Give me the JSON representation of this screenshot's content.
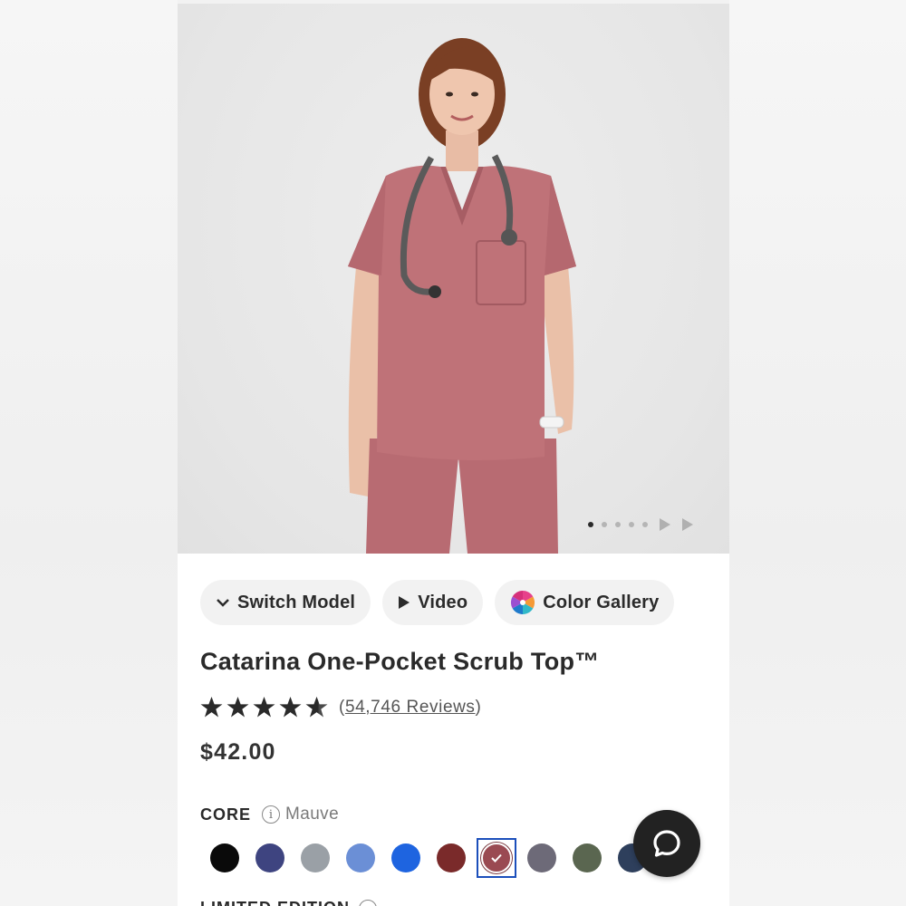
{
  "gallery": {
    "image_alt": "Model wearing mauve scrub top with stethoscope",
    "dot_count": 5,
    "active_dot": 0
  },
  "actions": {
    "switch_model": "Switch Model",
    "video": "Video",
    "color_gallery": "Color Gallery"
  },
  "product": {
    "title": "Catarina One-Pocket Scrub Top™",
    "rating": 4.5,
    "reviews_open": "(",
    "reviews_link": "54,746 Reviews",
    "reviews_close": ")",
    "price": "$42.00"
  },
  "color_section": {
    "label": "CORE",
    "selected_color": "Mauve",
    "swatches": [
      {
        "name": "black-swatch",
        "color": "#0a0a0a"
      },
      {
        "name": "navy-swatch",
        "color": "#3e4480"
      },
      {
        "name": "graphite-swatch",
        "color": "#9aa0a6"
      },
      {
        "name": "ceil-blue-swatch",
        "color": "#6b8fd6"
      },
      {
        "name": "royal-blue-swatch",
        "color": "#1e64e0"
      },
      {
        "name": "burgundy-swatch",
        "color": "#7a2a2a"
      },
      {
        "name": "mauve-swatch",
        "color": "#9a4a52",
        "selected": true
      },
      {
        "name": "charcoal-swatch",
        "color": "#6d6a78"
      },
      {
        "name": "olive-swatch",
        "color": "#5a6650"
      },
      {
        "name": "midnight-swatch",
        "color": "#2e3f5c"
      }
    ]
  },
  "limited": {
    "label": "LIMITED EDITION"
  },
  "colors": {
    "scrub": "#b86b72",
    "accent_blue": "#1b4fbb"
  }
}
